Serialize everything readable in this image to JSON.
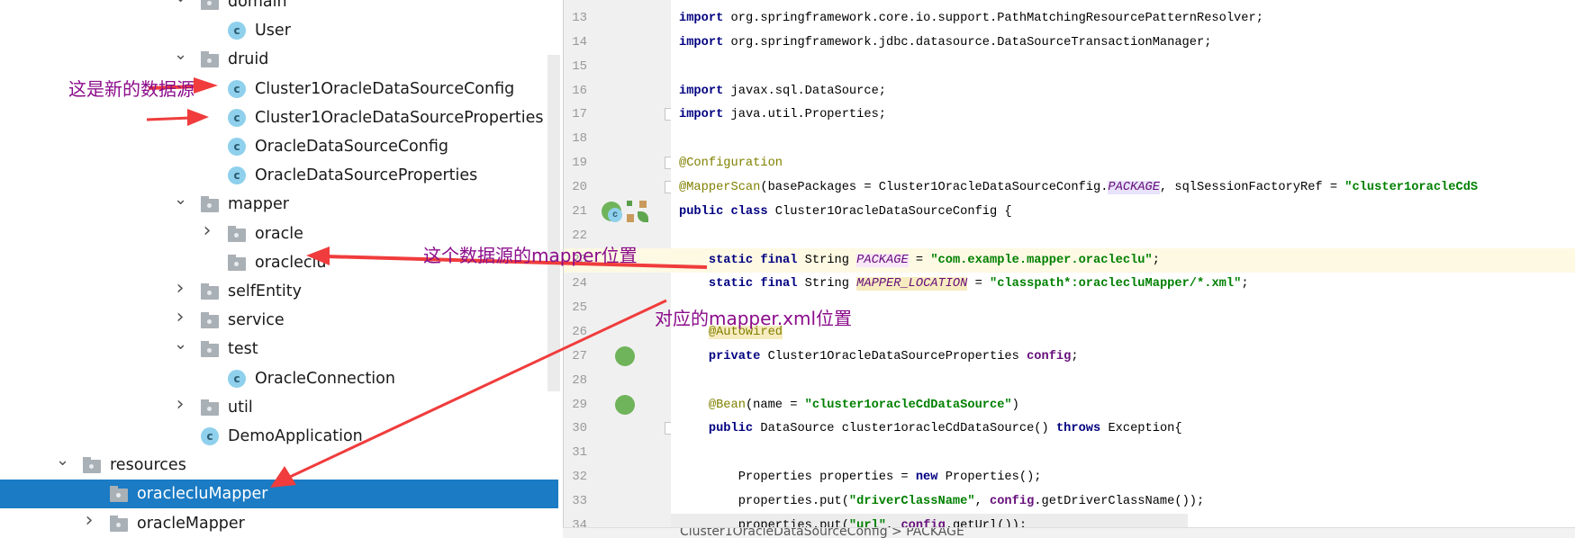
{
  "tree": {
    "items": [
      {
        "label": "domain",
        "type": "folder",
        "level": 2,
        "expanded": true
      },
      {
        "label": "User",
        "type": "class",
        "level": 3
      },
      {
        "label": "druid",
        "type": "folder",
        "level": 2,
        "expanded": true
      },
      {
        "label": "Cluster1OracleDataSourceConfig",
        "type": "class",
        "level": 3
      },
      {
        "label": "Cluster1OracleDataSourceProperties",
        "type": "class",
        "level": 3
      },
      {
        "label": "OracleDataSourceConfig",
        "type": "class",
        "level": 3
      },
      {
        "label": "OracleDataSourceProperties",
        "type": "class",
        "level": 3
      },
      {
        "label": "mapper",
        "type": "folder",
        "level": 2,
        "expanded": true
      },
      {
        "label": "oracle",
        "type": "folder",
        "level": 3,
        "expanded": false
      },
      {
        "label": "oracleclu",
        "type": "folder",
        "level": 3
      },
      {
        "label": "selfEntity",
        "type": "folder",
        "level": 2,
        "expanded": false
      },
      {
        "label": "service",
        "type": "folder",
        "level": 2,
        "expanded": false
      },
      {
        "label": "test",
        "type": "folder",
        "level": 2,
        "expanded": true
      },
      {
        "label": "OracleConnection",
        "type": "runnable-class",
        "level": 3
      },
      {
        "label": "util",
        "type": "folder",
        "level": 2,
        "expanded": false
      },
      {
        "label": "DemoApplication",
        "type": "spring-boot-class",
        "level": 2
      },
      {
        "label": "resources",
        "type": "resources-folder",
        "level": 0,
        "expanded": true
      },
      {
        "label": "oraclecluMapper",
        "type": "folder",
        "level": 1,
        "selected": true
      },
      {
        "label": "oracleMapper",
        "type": "folder",
        "level": 1,
        "expanded": false
      }
    ]
  },
  "editor": {
    "lines": [
      {
        "n": "13",
        "tokens": [
          [
            "kw",
            "import"
          ],
          [
            "",
            "org.springframework.core.io.support.PathMatchingResourcePatternResolver;"
          ]
        ]
      },
      {
        "n": "14",
        "tokens": [
          [
            "kw",
            "import"
          ],
          [
            "",
            "org.springframework.jdbc.datasource.DataSourceTransactionManager;"
          ]
        ]
      },
      {
        "n": "15",
        "tokens": []
      },
      {
        "n": "16",
        "tokens": [
          [
            "kw",
            "import"
          ],
          [
            "",
            "javax.sql.DataSource;"
          ]
        ]
      },
      {
        "n": "17",
        "tokens": [
          [
            "kw",
            "import"
          ],
          [
            "",
            "java.util.Properties;"
          ]
        ]
      },
      {
        "n": "18",
        "tokens": []
      },
      {
        "n": "19",
        "tokens": [
          [
            "ann",
            "@Configuration"
          ]
        ]
      },
      {
        "n": "20",
        "tokens": [
          [
            "ann",
            "@MapperScan"
          ],
          [
            "",
            "(basePackages = Cluster1OracleDataSourceConfig."
          ],
          [
            "const hl1",
            "PACKAGE"
          ],
          [
            "",
            ", sqlSessionFactoryRef = "
          ],
          [
            "str",
            "\"cluster1oracleCdS"
          ]
        ]
      },
      {
        "n": "21",
        "tokens": [
          [
            "kw",
            "public class"
          ],
          [
            "",
            "Cluster1OracleDataSourceConfig {"
          ]
        ]
      },
      {
        "n": "22",
        "tokens": []
      },
      {
        "n": "23",
        "tokens": [
          [
            "",
            "    "
          ],
          [
            "kw",
            "static final"
          ],
          [
            "",
            "String "
          ],
          [
            "const hl3",
            "PACKAGE"
          ],
          [
            "",
            " = "
          ],
          [
            "str",
            "\"com.example.mapper.oracleclu\""
          ],
          [
            "",
            ";"
          ]
        ],
        "current": true
      },
      {
        "n": "24",
        "tokens": [
          [
            "",
            "    "
          ],
          [
            "kw",
            "static final"
          ],
          [
            "",
            "String "
          ],
          [
            "const hl2",
            "MAPPER_LOCATION"
          ],
          [
            "",
            " = "
          ],
          [
            "str",
            "\"classpath*:oraclecluMapper/*.xml\""
          ],
          [
            "",
            ";"
          ]
        ]
      },
      {
        "n": "25",
        "tokens": []
      },
      {
        "n": "26",
        "tokens": [
          [
            "",
            "    "
          ],
          [
            "ann hl2",
            "@Autowired"
          ]
        ]
      },
      {
        "n": "27",
        "tokens": [
          [
            "",
            "    "
          ],
          [
            "kw",
            "private"
          ],
          [
            "",
            "Cluster1OracleDataSourceProperties "
          ],
          [
            "field",
            "config"
          ],
          [
            "",
            ";"
          ]
        ]
      },
      {
        "n": "28",
        "tokens": []
      },
      {
        "n": "29",
        "tokens": [
          [
            "",
            "    "
          ],
          [
            "ann",
            "@Bean"
          ],
          [
            "",
            "(name = "
          ],
          [
            "str",
            "\"cluster1oracleCdDataSource\""
          ],
          [
            "",
            ")"
          ]
        ]
      },
      {
        "n": "30",
        "tokens": [
          [
            "",
            "    "
          ],
          [
            "kw",
            "public"
          ],
          [
            "",
            "DataSource cluster1oracleCdDataSource() "
          ],
          [
            "kw",
            "throws"
          ],
          [
            "",
            "Exception{"
          ]
        ]
      },
      {
        "n": "31",
        "tokens": []
      },
      {
        "n": "32",
        "tokens": [
          [
            "",
            "        Properties properties = "
          ],
          [
            "kw",
            "new"
          ],
          [
            "",
            "Properties();"
          ]
        ]
      },
      {
        "n": "33",
        "tokens": [
          [
            "",
            "        properties.put("
          ],
          [
            "str",
            "\"driverClassName\""
          ],
          [
            "",
            ", "
          ],
          [
            "field",
            "config"
          ],
          [
            "",
            ".getDriverClassName());"
          ]
        ]
      },
      {
        "n": "34",
        "tokens": [
          [
            "",
            "        properties.put("
          ],
          [
            "str",
            "\"url\""
          ],
          [
            "",
            ", "
          ],
          [
            "field",
            "config"
          ],
          [
            "",
            ".getUrl());"
          ]
        ],
        "gray": true
      }
    ]
  },
  "status": {
    "breadcrumb": "Cluster1OracleDataSourceConfig > PACKAGE"
  },
  "annotations": {
    "new_datasource": "这是新的数据源",
    "mapper_location": "这个数据源的mapper位置",
    "xml_location": "对应的mapper.xml位置",
    "text_color": "#8b0c8b",
    "arrow_color": "#f03c3c"
  },
  "colors": {
    "selection": "#1b7bc4",
    "keyword": "#000080",
    "string": "#008000",
    "annotation": "#808000"
  }
}
